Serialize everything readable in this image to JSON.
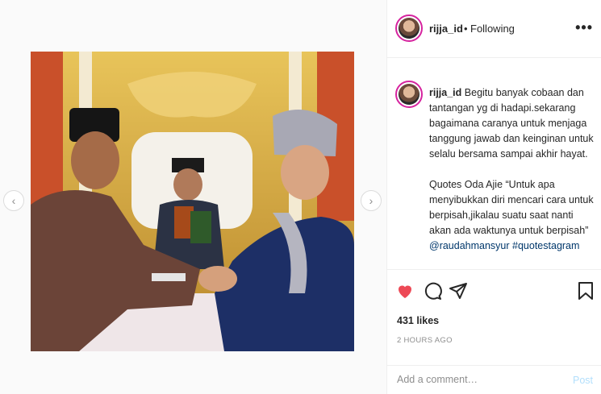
{
  "header": {
    "username": "rijja_id",
    "separator": "•",
    "follow_status": "Following",
    "more_label": "•••"
  },
  "caption": {
    "username": "rijja_id",
    "text_1": "Begitu banyak cobaan dan tantangan yg di hadapi.sekarang bagaimana caranya untuk menjaga tanggung jawab dan keinginan untuk selalu bersama sampai akhir hayat.",
    "text_2": "Quotes Oda Ajie “Untuk apa menyibukkan diri mencari cara untuk berpisah,jikalau suatu saat nanti akan ada waktunya untuk berpisah”",
    "mention": "@raudahmansyur",
    "hashtag": "#quotestagram"
  },
  "actions": {
    "likes": "431 likes",
    "time": "2 HOURS AGO"
  },
  "comment": {
    "placeholder": "Add a comment…",
    "post_label": "Post"
  },
  "navigation": {
    "prev": "‹",
    "next": "›"
  },
  "colors": {
    "like_red": "#ed4956",
    "link_blue": "#00376b",
    "post_disabled": "#b2dffc"
  }
}
